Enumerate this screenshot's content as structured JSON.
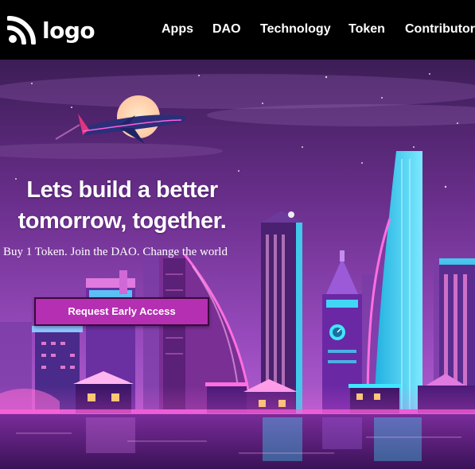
{
  "header": {
    "logo_text": "logo",
    "logo_icon": "rss-feed-icon",
    "nav": [
      {
        "label": "Apps"
      },
      {
        "label": "DAO"
      },
      {
        "label": "Technology"
      },
      {
        "label": "Token"
      },
      {
        "label": "Contributor"
      }
    ]
  },
  "hero": {
    "headline_line1": "Lets build a better",
    "headline_line2": "tomorrow, together.",
    "subtitle": "Buy 1 Token. Join the DAO. Change the world",
    "cta_label": "Request Early Access",
    "background": "neon-city-night-illustration"
  },
  "colors": {
    "header_bg": "#000000",
    "cta_bg": "#b52fb2",
    "sky_top": "#3c1d56",
    "sky_mid": "#8a3fa8",
    "neon_cyan": "#3ee8ff",
    "neon_pink": "#ff4fd8"
  }
}
